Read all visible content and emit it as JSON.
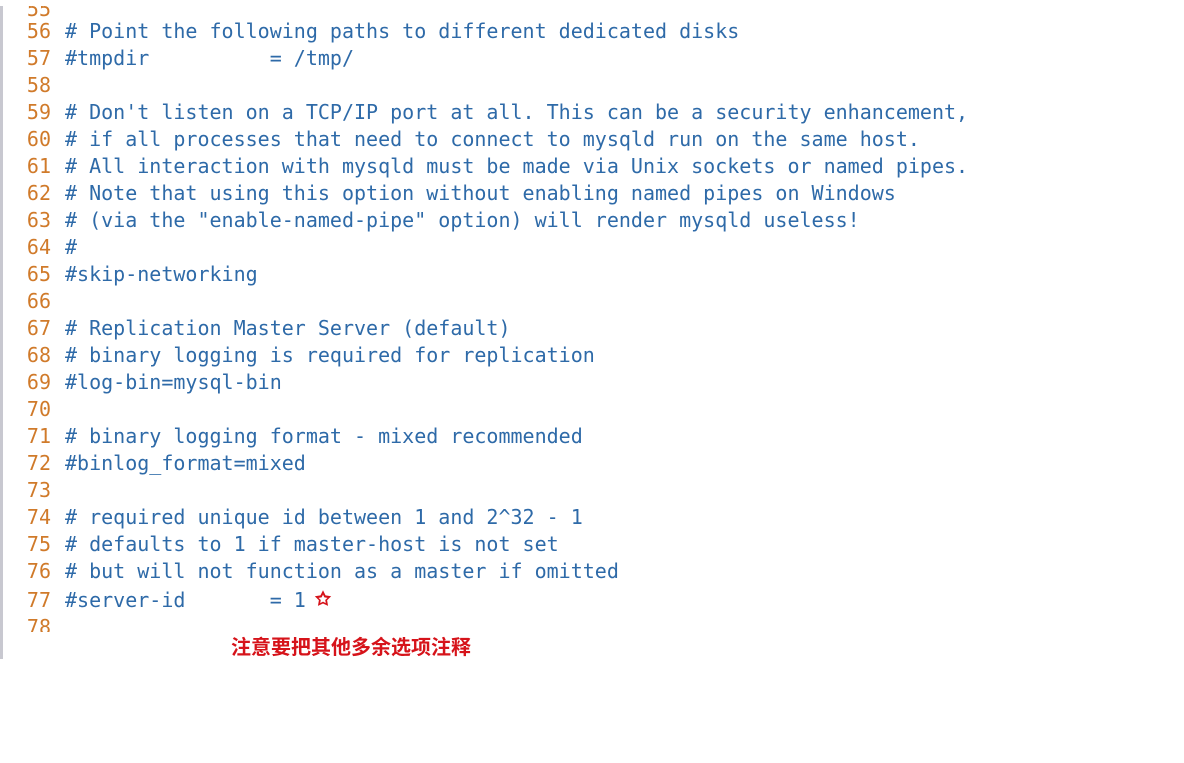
{
  "lines": [
    {
      "n": "55",
      "text": "",
      "partialTop": true
    },
    {
      "n": "56",
      "text": "# Point the following paths to different dedicated disks"
    },
    {
      "n": "57",
      "text": "#tmpdir          = /tmp/"
    },
    {
      "n": "58",
      "text": ""
    },
    {
      "n": "59",
      "text": "# Don't listen on a TCP/IP port at all. This can be a security enhancement,"
    },
    {
      "n": "60",
      "text": "# if all processes that need to connect to mysqld run on the same host."
    },
    {
      "n": "61",
      "text": "# All interaction with mysqld must be made via Unix sockets or named pipes."
    },
    {
      "n": "62",
      "text": "# Note that using this option without enabling named pipes on Windows"
    },
    {
      "n": "63",
      "text": "# (via the \"enable-named-pipe\" option) will render mysqld useless!"
    },
    {
      "n": "64",
      "text": "#"
    },
    {
      "n": "65",
      "text": "#skip-networking"
    },
    {
      "n": "66",
      "text": ""
    },
    {
      "n": "67",
      "text": "# Replication Master Server (default)"
    },
    {
      "n": "68",
      "text": "# binary logging is required for replication"
    },
    {
      "n": "69",
      "text": "#log-bin=mysql-bin"
    },
    {
      "n": "70",
      "text": ""
    },
    {
      "n": "71",
      "text": "# binary logging format - mixed recommended"
    },
    {
      "n": "72",
      "text": "#binlog_format=mixed"
    },
    {
      "n": "73",
      "text": ""
    },
    {
      "n": "74",
      "text": "# required unique id between 1 and 2^32 - 1"
    },
    {
      "n": "75",
      "text": "# defaults to 1 if master-host is not set"
    },
    {
      "n": "76",
      "text": "# but will not function as a master if omitted"
    },
    {
      "n": "77",
      "text": "#server-id       = 1",
      "star": true
    },
    {
      "n": "78",
      "text": "",
      "partialBottom": true
    }
  ],
  "annotation": "注意要把其他多余选项注释",
  "colors": {
    "lineNumber": "#d07a2a",
    "comment": "#2e6aa8",
    "annotation": "#d6131a",
    "gutterBorder": "#c8c8d0"
  }
}
